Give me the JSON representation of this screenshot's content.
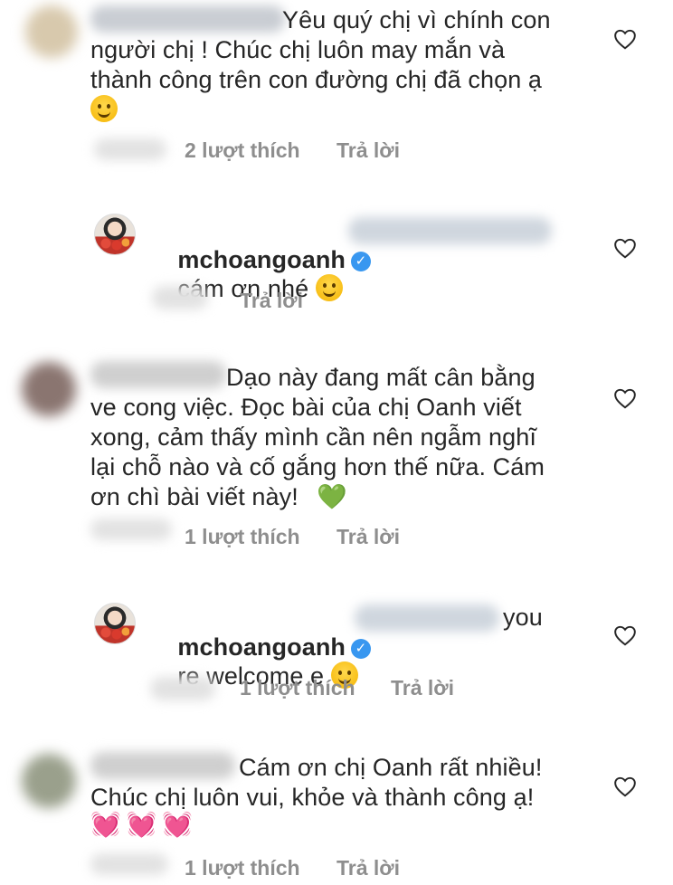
{
  "comments": [
    {
      "text": "Yêu quý chị vì chính con\nngười chị ! Chúc chị luôn may mắn và\nthành công trên con đường chị đã chọn ạ",
      "likes": "2 lượt thích",
      "reply": "Trả lời"
    },
    {
      "username": "mchoangoanh",
      "text": "cám ơn nhé",
      "reply": "Trả lời"
    },
    {
      "text": "Dạo này đang mất cân bằng\nve cong việc. Đọc bài của chị Oanh viết\nxong, cảm thấy mình cần nên ngẫm nghĩ\nlại chỗ nào và cố gắng hơn thế nữa. Cám\nơn chì bài viết này!",
      "likes": "1 lượt thích",
      "reply": "Trả lời"
    },
    {
      "username": "mchoangoanh",
      "text_tail": "you",
      "text": "re welcome e",
      "likes": "1 lượt thích",
      "reply": "Trả lời"
    },
    {
      "text": "Cám ơn chị Oanh rất nhiều!\nChúc chị luôn vui, khỏe và thành công ạ!",
      "likes": "1 lượt thích",
      "reply": "Trả lời"
    }
  ],
  "icons": {
    "verified": "verified-badge-icon",
    "like": "heart-outline-icon"
  },
  "colors": {
    "text": "#262626",
    "meta": "#8e8e8e",
    "verified": "#3897f0"
  }
}
